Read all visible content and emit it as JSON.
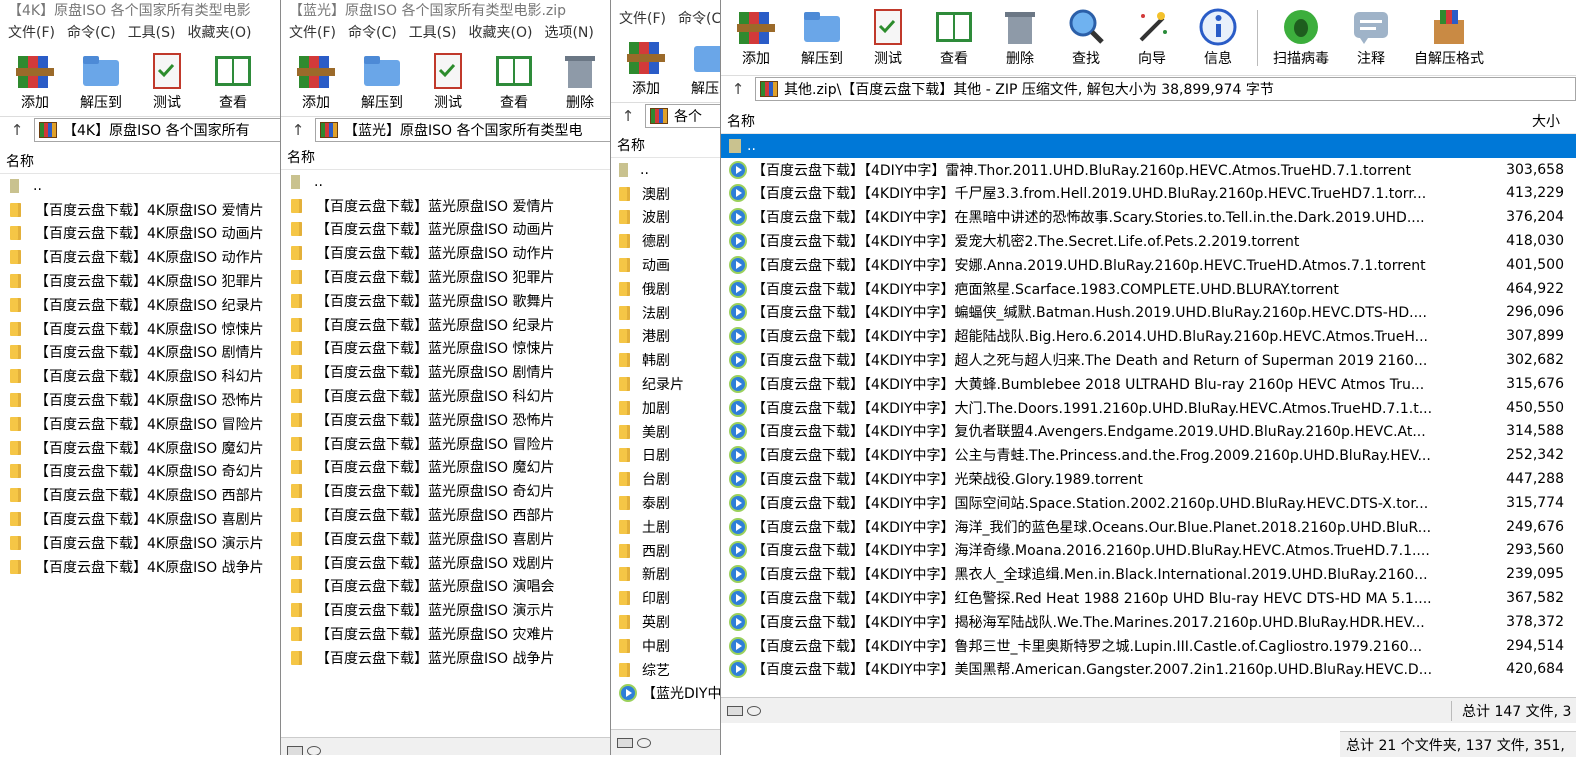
{
  "menu": [
    "文件(F)",
    "命令(C)",
    "工具(S)",
    "收藏夹(O)",
    "选项(N)"
  ],
  "toolbar": {
    "add": "添加",
    "extract": "解压到",
    "test": "测试",
    "view": "查看",
    "delete": "删除",
    "find": "查找",
    "wizard": "向导",
    "info": "信息",
    "virus": "扫描病毒",
    "comment": "注释",
    "sfx": "自解压格式"
  },
  "col_name": "名称",
  "col_size": "大小",
  "parent": "..",
  "win1": {
    "title": "【4K】原盘ISO 各个国家所有类型电影",
    "path": "【4K】原盘ISO 各个国家所有",
    "items": [
      "【百度云盘下载】4K原盘ISO 爱情片",
      "【百度云盘下载】4K原盘ISO 动画片",
      "【百度云盘下载】4K原盘ISO 动作片",
      "【百度云盘下载】4K原盘ISO 犯罪片",
      "【百度云盘下载】4K原盘ISO 纪录片",
      "【百度云盘下载】4K原盘ISO 惊悚片",
      "【百度云盘下载】4K原盘ISO 剧情片",
      "【百度云盘下载】4K原盘ISO 科幻片",
      "【百度云盘下载】4K原盘ISO 恐怖片",
      "【百度云盘下载】4K原盘ISO 冒险片",
      "【百度云盘下载】4K原盘ISO 魔幻片",
      "【百度云盘下载】4K原盘ISO 奇幻片",
      "【百度云盘下载】4K原盘ISO 西部片",
      "【百度云盘下载】4K原盘ISO 喜剧片",
      "【百度云盘下载】4K原盘ISO 演示片",
      "【百度云盘下载】4K原盘ISO 战争片"
    ]
  },
  "win2": {
    "title": "【蓝光】原盘ISO 各个国家所有类型电影.zip",
    "path": "【蓝光】原盘ISO 各个国家所有类型电",
    "items": [
      "【百度云盘下载】蓝光原盘ISO 爱情片",
      "【百度云盘下载】蓝光原盘ISO 动画片",
      "【百度云盘下载】蓝光原盘ISO 动作片",
      "【百度云盘下载】蓝光原盘ISO 犯罪片",
      "【百度云盘下载】蓝光原盘ISO 歌舞片",
      "【百度云盘下载】蓝光原盘ISO 纪录片",
      "【百度云盘下载】蓝光原盘ISO 惊悚片",
      "【百度云盘下载】蓝光原盘ISO 剧情片",
      "【百度云盘下载】蓝光原盘ISO 科幻片",
      "【百度云盘下载】蓝光原盘ISO 恐怖片",
      "【百度云盘下载】蓝光原盘ISO 冒险片",
      "【百度云盘下载】蓝光原盘ISO 魔幻片",
      "【百度云盘下载】蓝光原盘ISO 奇幻片",
      "【百度云盘下载】蓝光原盘ISO 西部片",
      "【百度云盘下载】蓝光原盘ISO 喜剧片",
      "【百度云盘下载】蓝光原盘ISO 戏剧片",
      "【百度云盘下载】蓝光原盘ISO 演唱会",
      "【百度云盘下载】蓝光原盘ISO 演示片",
      "【百度云盘下载】蓝光原盘ISO 灾难片",
      "【百度云盘下载】蓝光原盘ISO 战争片"
    ]
  },
  "win3": {
    "path": "各个",
    "items": [
      "澳剧",
      "波剧",
      "德剧",
      "动画",
      "俄剧",
      "法剧",
      "港剧",
      "韩剧",
      "纪录片",
      "加剧",
      "美剧",
      "日剧",
      "台剧",
      "泰剧",
      "土剧",
      "西剧",
      "新剧",
      "印剧",
      "英剧",
      "中剧",
      "综艺"
    ],
    "extra": "【蓝光DIY中",
    "status": "总计 21 个文件夹, 137 文件, 351,"
  },
  "win4": {
    "path": "其他.zip\\【百度云盘下载】其他 - ZIP 压缩文件, 解包大小为 38,899,974 字节",
    "files": [
      {
        "name": "【百度云盘下载】【4DIY中字】雷神.Thor.2011.UHD.BluRay.2160p.HEVC.Atmos.TrueHD.7.1.torrent",
        "size": "303,658"
      },
      {
        "name": "【百度云盘下载】【4KDIY中字】千尸屋3.3.from.Hell.2019.UHD.BluRay.2160p.HEVC.TrueHD7.1.torr...",
        "size": "413,229"
      },
      {
        "name": "【百度云盘下载】【4KDIY中字】在黑暗中讲述的恐怖故事.Scary.Stories.to.Tell.in.the.Dark.2019.UHD....",
        "size": "376,204"
      },
      {
        "name": "【百度云盘下载】【4KDIY中字】爱宠大机密2.The.Secret.Life.of.Pets.2.2019.torrent",
        "size": "418,030"
      },
      {
        "name": "【百度云盘下载】【4KDIY中字】安娜.Anna.2019.UHD.BluRay.2160p.HEVC.TrueHD.Atmos.7.1.torrent",
        "size": "401,500"
      },
      {
        "name": "【百度云盘下载】【4KDIY中字】疤面煞星.Scarface.1983.COMPLETE.UHD.BLURAY.torrent",
        "size": "464,922"
      },
      {
        "name": "【百度云盘下载】【4KDIY中字】蝙蝠侠_缄默.Batman.Hush.2019.UHD.BluRay.2160p.HEVC.DTS-HD....",
        "size": "296,096"
      },
      {
        "name": "【百度云盘下载】【4KDIY中字】超能陆战队.Big.Hero.6.2014.UHD.BluRay.2160p.HEVC.Atmos.TrueH...",
        "size": "307,899"
      },
      {
        "name": "【百度云盘下载】【4KDIY中字】超人之死与超人归来.The Death and Return of Superman 2019 2160...",
        "size": "302,682"
      },
      {
        "name": "【百度云盘下载】【4KDIY中字】大黄蜂.Bumblebee 2018 ULTRAHD Blu-ray 2160p HEVC Atmos Tru...",
        "size": "315,676"
      },
      {
        "name": "【百度云盘下载】【4KDIY中字】大门.The.Doors.1991.2160p.UHD.BluRay.HEVC.Atmos.TrueHD.7.1.t...",
        "size": "450,550"
      },
      {
        "name": "【百度云盘下载】【4KDIY中字】复仇者联盟4.Avengers.Endgame.2019.UHD.BluRay.2160p.HEVC.At...",
        "size": "314,588"
      },
      {
        "name": "【百度云盘下载】【4KDIY中字】公主与青蛙.The.Princess.and.the.Frog.2009.2160p.UHD.BluRay.HEV...",
        "size": "252,342"
      },
      {
        "name": "【百度云盘下载】【4KDIY中字】光荣战役.Glory.1989.torrent",
        "size": "447,288"
      },
      {
        "name": "【百度云盘下载】【4KDIY中字】国际空间站.Space.Station.2002.2160p.UHD.BluRay.HEVC.DTS-X.tor...",
        "size": "315,774"
      },
      {
        "name": "【百度云盘下载】【4KDIY中字】海洋_我们的蓝色星球.Oceans.Our.Blue.Planet.2018.2160p.UHD.BluR...",
        "size": "249,676"
      },
      {
        "name": "【百度云盘下载】【4KDIY中字】海洋奇缘.Moana.2016.2160p.UHD.BluRay.HEVC.Atmos.TrueHD.7.1....",
        "size": "293,560"
      },
      {
        "name": "【百度云盘下载】【4KDIY中字】黑衣人_全球追缉.Men.in.Black.International.2019.UHD.BluRay.2160...",
        "size": "239,095"
      },
      {
        "name": "【百度云盘下载】【4KDIY中字】红色警探.Red Heat 1988 2160p UHD Blu-ray HEVC DTS-HD MA 5.1....",
        "size": "367,582"
      },
      {
        "name": "【百度云盘下载】【4KDIY中字】揭秘海军陆战队.We.The.Marines.2017.2160p.UHD.BluRay.HDR.HEV...",
        "size": "378,372"
      },
      {
        "name": "【百度云盘下载】【4KDIY中字】鲁邦三世_卡里奥斯特罗之城.Lupin.III.Castle.of.Cagliostro.1979.2160...",
        "size": "294,514"
      },
      {
        "name": "【百度云盘下载】【4KDIY中字】美国黑帮.American.Gangster.2007.2in1.2160p.UHD.BluRay.HEVC.D...",
        "size": "420,684"
      }
    ],
    "status": "总计 147 文件, 3"
  }
}
